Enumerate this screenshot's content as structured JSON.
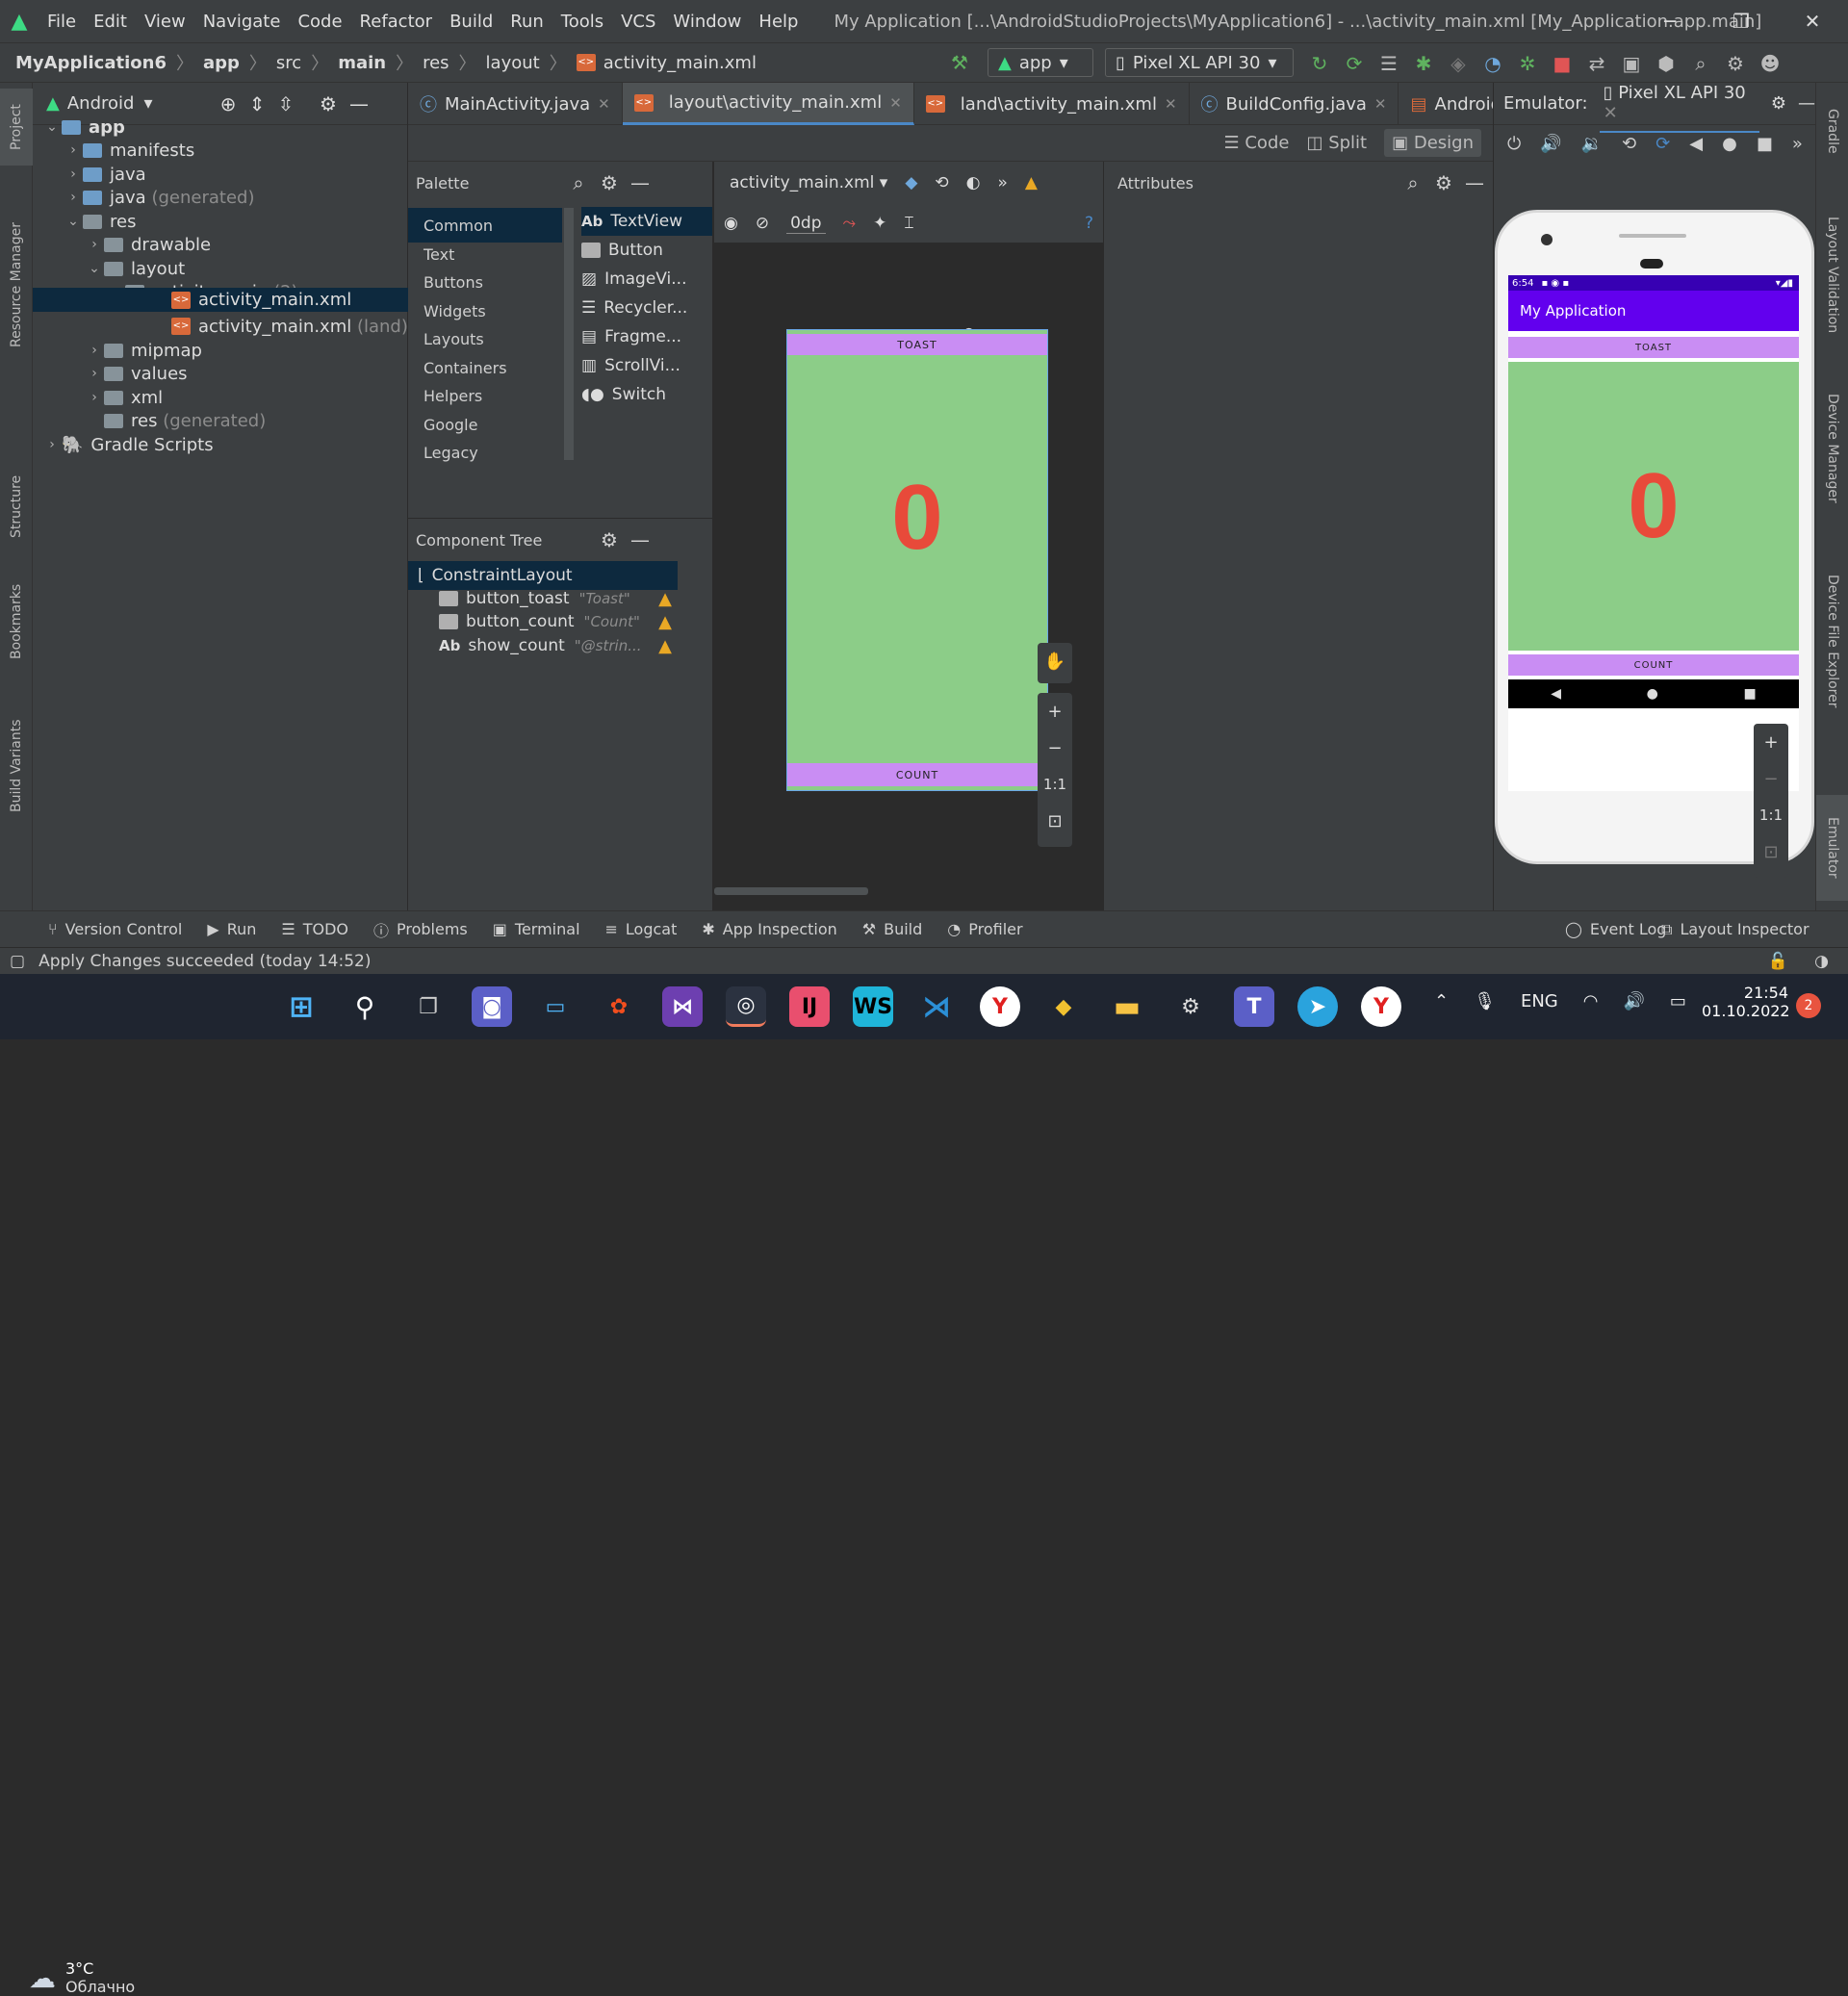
{
  "titlebar": {
    "menu": [
      "File",
      "Edit",
      "View",
      "Navigate",
      "Code",
      "Refactor",
      "Build",
      "Run",
      "Tools",
      "VCS",
      "Window",
      "Help"
    ],
    "window_title": "My Application [...\\AndroidStudioProjects\\MyApplication6] - ...\\activity_main.xml [My_Application.app.main]"
  },
  "navbar": {
    "breadcrumbs": [
      "MyApplication6",
      "app",
      "src",
      "main",
      "res",
      "layout",
      "activity_main.xml"
    ],
    "run_config": "app",
    "device": "Pixel XL API 30"
  },
  "project": {
    "view_label": "Android",
    "tree": [
      {
        "label": "app",
        "level": 0,
        "suffix": ""
      },
      {
        "label": "manifests",
        "level": 1,
        "suffix": ""
      },
      {
        "label": "java",
        "level": 1,
        "suffix": ""
      },
      {
        "label": "java",
        "level": 1,
        "suffix": "(generated)"
      },
      {
        "label": "res",
        "level": 1,
        "suffix": ""
      },
      {
        "label": "drawable",
        "level": 2,
        "suffix": ""
      },
      {
        "label": "layout",
        "level": 2,
        "suffix": ""
      },
      {
        "label": "activity_main",
        "level": 3,
        "suffix": "(2)"
      },
      {
        "label": "activity_main.xml",
        "level": 4,
        "suffix": ""
      },
      {
        "label": "activity_main.xml",
        "level": 4,
        "suffix": "(land)"
      },
      {
        "label": "mipmap",
        "level": 2,
        "suffix": ""
      },
      {
        "label": "values",
        "level": 2,
        "suffix": ""
      },
      {
        "label": "xml",
        "level": 2,
        "suffix": ""
      },
      {
        "label": "res",
        "level": 1,
        "suffix": "(generated)"
      },
      {
        "label": "Gradle Scripts",
        "level": 0,
        "suffix": ""
      }
    ]
  },
  "left_tool_tabs": [
    "Project",
    "Resource Manager",
    "Structure",
    "Bookmarks",
    "Build Variants"
  ],
  "right_tool_tabs": [
    "Gradle",
    "Layout Validation",
    "Device Manager",
    "Device File Explorer",
    "Emulator"
  ],
  "editor_tabs": [
    "MainActivity.java",
    "layout\\activity_main.xml",
    "land\\activity_main.xml",
    "BuildConfig.java",
    "AndroidM"
  ],
  "modes": [
    "Code",
    "Split",
    "Design"
  ],
  "palette": {
    "title": "Palette",
    "categories": [
      "Common",
      "Text",
      "Buttons",
      "Widgets",
      "Layouts",
      "Containers",
      "Helpers",
      "Google",
      "Legacy"
    ],
    "items": [
      "TextView",
      "Button",
      "ImageVi...",
      "Recycler...",
      "Fragme...",
      "ScrollVi...",
      "Switch"
    ]
  },
  "component_tree": {
    "title": "Component Tree",
    "root": "ConstraintLayout",
    "children": [
      {
        "name": "button_toast",
        "hint": "\"Toast\""
      },
      {
        "name": "button_count",
        "hint": "\"Count\""
      },
      {
        "name": "show_count",
        "hint": "\"@strin..."
      }
    ]
  },
  "design_toolbar": {
    "file": "activity_main.xml",
    "margin": "0dp"
  },
  "attributes_title": "Attributes",
  "preview": {
    "toast_label": "TOAST",
    "count_label": "COUNT",
    "count_value": "0"
  },
  "zoom_controls": {
    "fit": "1:1"
  },
  "emulator": {
    "title": "Emulator:",
    "device": "Pixel XL API 30",
    "clock": "6:54",
    "app_title": "My Application",
    "toast_label": "TOAST",
    "count_label": "COUNT",
    "count_value": "0"
  },
  "bottom_tools": [
    "Version Control",
    "Run",
    "TODO",
    "Problems",
    "Terminal",
    "Logcat",
    "App Inspection",
    "Build",
    "Profiler"
  ],
  "bottom_tools_right": [
    "Event Log",
    "Layout Inspector"
  ],
  "status_message": "Apply Changes succeeded (today 14:52)",
  "taskbar": {
    "weather_temp": "3°C",
    "weather_desc": "Облачно",
    "lang": "ENG",
    "time": "21:54",
    "date": "01.10.2022",
    "notifications": "2"
  },
  "colors": {
    "ide_bg": "#3c3f41",
    "editor_bg": "#2b2b2b",
    "preview_green": "#8ccd88",
    "button_purple": "#c98df3",
    "count_red": "#e84a3a",
    "app_bar_purple": "#6200ee",
    "accent_blue": "#4a88c7"
  }
}
